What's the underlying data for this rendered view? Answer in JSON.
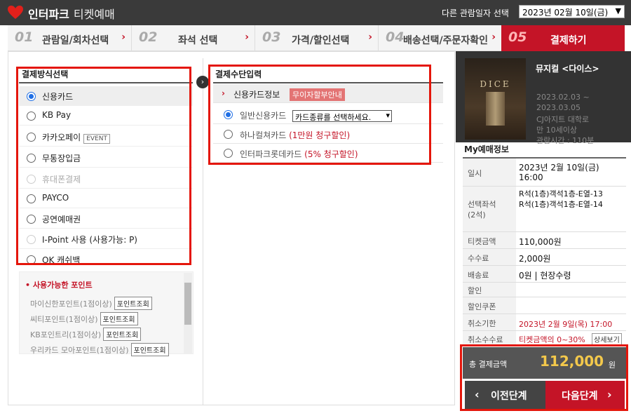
{
  "header": {
    "logo": "인터파크",
    "logo_sub": "티켓예매",
    "other_date_label": "다른 관람일자 선택",
    "selected_date": "2023년 02월 10일(금)"
  },
  "steps": [
    {
      "num": "01",
      "label": "관람일/회차선택"
    },
    {
      "num": "02",
      "label": "좌석 선택"
    },
    {
      "num": "03",
      "label": "가격/할인선택"
    },
    {
      "num": "04",
      "label": "배송선택/주문자확인"
    },
    {
      "num": "05",
      "label": "결제하기"
    }
  ],
  "payment_methods": {
    "title": "결제방식선택",
    "items": [
      {
        "label": "신용카드",
        "selected": true,
        "disabled": false
      },
      {
        "label": "KB Pay",
        "selected": false,
        "disabled": false
      },
      {
        "label": "카카오페이",
        "selected": false,
        "disabled": false,
        "badge": "EVENT"
      },
      {
        "label": "무통장입금",
        "selected": false,
        "disabled": false
      },
      {
        "label": "휴대폰결제",
        "selected": false,
        "disabled": true
      },
      {
        "label": "PAYCO",
        "selected": false,
        "disabled": false
      },
      {
        "label": "공연예매권",
        "selected": false,
        "disabled": false
      },
      {
        "label": "I-Point 사용 (사용가능: P)",
        "selected": false,
        "disabled": true
      },
      {
        "label": "OK 캐쉬백",
        "selected": false,
        "disabled": false
      }
    ]
  },
  "points": {
    "title": "사용가능한 포인트",
    "button_label": "포인트조회",
    "items": [
      "마이신한포인트(1점이상)",
      "씨티포인트(1점이상)",
      "KB포인트리(1점이상)",
      "우리카드 모아포인트(1점이상)"
    ]
  },
  "payment_input": {
    "title": "결제수단입력",
    "card_info_label": "신용카드정보",
    "interest_free_badge": "무이자할부안내",
    "options": [
      {
        "label": "일반신용카드",
        "selected": true
      },
      {
        "label": "하나컬쳐카드",
        "promo": "(1만원 청구할인)",
        "selected": false
      },
      {
        "label": "인터파크롯데카드",
        "promo": "(5% 청구할인)",
        "selected": false
      }
    ],
    "card_select_placeholder": "카드종류를 선택하세요."
  },
  "show": {
    "title": "뮤지컬 <다이스>",
    "poster_text": "DICE",
    "period_start": "2023.02.03 ~",
    "period_end": "2023.03.05",
    "venue_line1": "CJ아지트 대학로",
    "age": "만 10세이상",
    "runtime": "관람시간 : 110분"
  },
  "my_booking": {
    "title": "My예매정보",
    "date_label": "일시",
    "date_value_1": "2023년 2월 10일(금)",
    "date_value_2": "16:00",
    "seat_label_1": "선택좌석",
    "seat_label_2": "(2석)",
    "seat_1": "R석(1층)객석1층-E열-13",
    "seat_2": "R석(1층)객석1층-E열-14",
    "ticket_label": "티켓금액",
    "ticket_value": "110,000원",
    "fee_label": "수수료",
    "fee_value": "2,000원",
    "delivery_label": "배송료",
    "delivery_value": "0원 | 현장수령",
    "discount_label": "할인",
    "coupon_label": "할인쿠폰",
    "cancel_deadline_label": "취소기한",
    "cancel_deadline_value": "2023년 2월 9일(목) 17:00",
    "cancel_fee_label": "취소수수료",
    "cancel_fee_value": "티켓금액의 0~30%",
    "detail_button": "상세보기",
    "total_label": "총 결제금액",
    "total_value": "112,000",
    "total_unit": "원"
  },
  "nav": {
    "prev_label": "이전단계",
    "next_label": "다음단계"
  }
}
